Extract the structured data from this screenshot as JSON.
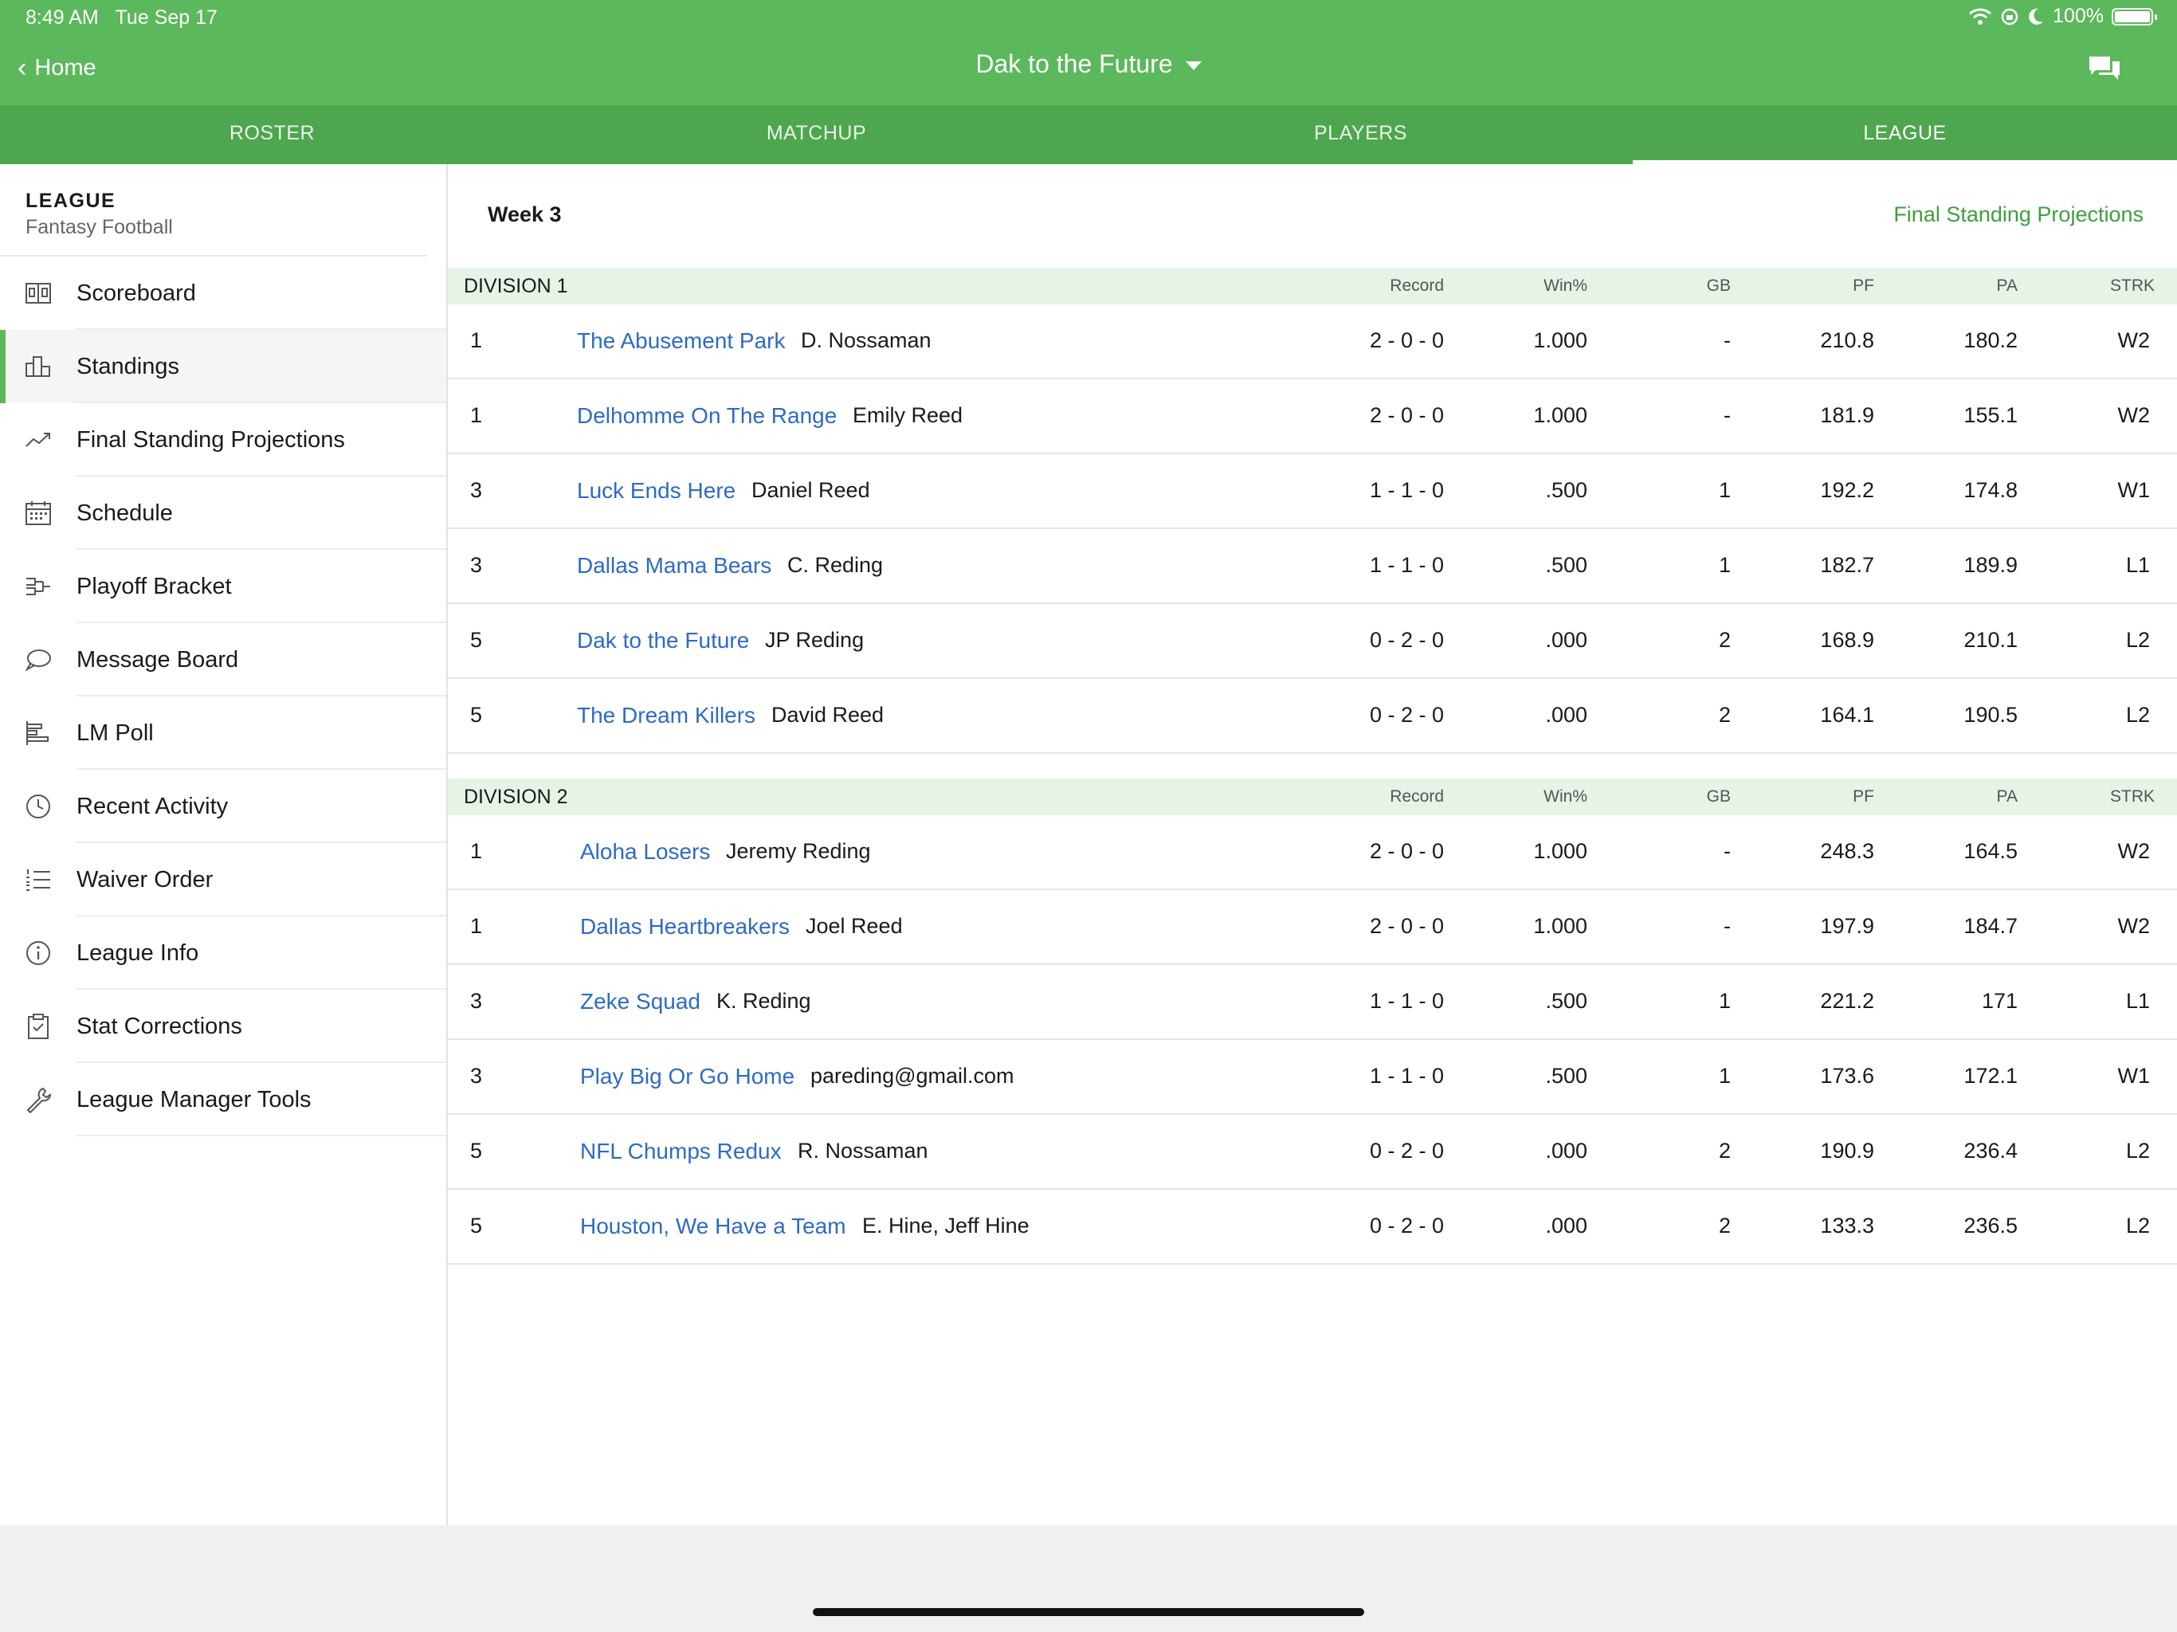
{
  "status_bar": {
    "time": "8:49 AM",
    "date": "Tue Sep 17",
    "battery": "100%",
    "battery_level": 1.0
  },
  "nav": {
    "back_label": "Home",
    "title": "Dak to the Future"
  },
  "tabs": [
    {
      "label": "ROSTER",
      "active": false
    },
    {
      "label": "MATCHUP",
      "active": false
    },
    {
      "label": "PLAYERS",
      "active": false
    },
    {
      "label": "LEAGUE",
      "active": true
    }
  ],
  "sidebar": {
    "title": "LEAGUE",
    "subtitle": "Fantasy Football",
    "items": [
      {
        "label": "Scoreboard",
        "icon": "scoreboard-icon"
      },
      {
        "label": "Standings",
        "icon": "standings-icon",
        "active": true
      },
      {
        "label": "Final Standing Projections",
        "icon": "trend-icon"
      },
      {
        "label": "Schedule",
        "icon": "calendar-icon"
      },
      {
        "label": "Playoff Bracket",
        "icon": "bracket-icon"
      },
      {
        "label": "Message Board",
        "icon": "speech-bubble-icon"
      },
      {
        "label": "LM Poll",
        "icon": "poll-icon"
      },
      {
        "label": "Recent Activity",
        "icon": "clock-icon"
      },
      {
        "label": "Waiver Order",
        "icon": "numbered-list-icon"
      },
      {
        "label": "League Info",
        "icon": "info-icon"
      },
      {
        "label": "Stat Corrections",
        "icon": "clipboard-icon"
      },
      {
        "label": "League Manager Tools",
        "icon": "wrench-icon"
      }
    ]
  },
  "main": {
    "week": "Week 3",
    "projections_link": "Final Standing Projections",
    "columns": {
      "record": "Record",
      "win_pct": "Win%",
      "gb": "GB",
      "pf": "PF",
      "pa": "PA",
      "strk": "STRK"
    },
    "divisions": [
      {
        "name": "DIVISION 1",
        "rows": [
          {
            "rank": "1",
            "team": "The Abusement Park",
            "owner": "D. Nossaman",
            "record": "2 - 0 - 0",
            "win_pct": "1.000",
            "gb": "-",
            "pf": "210.8",
            "pa": "180.2",
            "strk": "W2"
          },
          {
            "rank": "1",
            "team": "Delhomme On The Range",
            "owner": "Emily Reed",
            "record": "2 - 0 - 0",
            "win_pct": "1.000",
            "gb": "-",
            "pf": "181.9",
            "pa": "155.1",
            "strk": "W2"
          },
          {
            "rank": "3",
            "team": "Luck Ends Here",
            "owner": "Daniel Reed",
            "record": "1 - 1 - 0",
            "win_pct": ".500",
            "gb": "1",
            "pf": "192.2",
            "pa": "174.8",
            "strk": "W1"
          },
          {
            "rank": "3",
            "team": "Dallas Mama Bears",
            "owner": "C. Reding",
            "record": "1 - 1 - 0",
            "win_pct": ".500",
            "gb": "1",
            "pf": "182.7",
            "pa": "189.9",
            "strk": "L1"
          },
          {
            "rank": "5",
            "team": "Dak to the Future",
            "owner": "JP Reding",
            "record": "0 - 2 - 0",
            "win_pct": ".000",
            "gb": "2",
            "pf": "168.9",
            "pa": "210.1",
            "strk": "L2"
          },
          {
            "rank": "5",
            "team": "The Dream Killers",
            "owner": "David Reed",
            "record": "0 - 2 - 0",
            "win_pct": ".000",
            "gb": "2",
            "pf": "164.1",
            "pa": "190.5",
            "strk": "L2"
          }
        ]
      },
      {
        "name": "DIVISION 2",
        "rows": [
          {
            "rank": "1",
            "team": "Aloha Losers",
            "owner": "Jeremy Reding",
            "record": "2 - 0 - 0",
            "win_pct": "1.000",
            "gb": "-",
            "pf": "248.3",
            "pa": "164.5",
            "strk": "W2"
          },
          {
            "rank": "1",
            "team": "Dallas Heartbreakers",
            "owner": "Joel Reed",
            "record": "2 - 0 - 0",
            "win_pct": "1.000",
            "gb": "-",
            "pf": "197.9",
            "pa": "184.7",
            "strk": "W2"
          },
          {
            "rank": "3",
            "team": "Zeke Squad",
            "owner": "K. Reding",
            "record": "1 - 1 - 0",
            "win_pct": ".500",
            "gb": "1",
            "pf": "221.2",
            "pa": "171",
            "strk": "L1"
          },
          {
            "rank": "3",
            "team": "Play Big Or Go Home",
            "owner": "pareding@gmail.com",
            "record": "1 - 1 - 0",
            "win_pct": ".500",
            "gb": "1",
            "pf": "173.6",
            "pa": "172.1",
            "strk": "W1"
          },
          {
            "rank": "5",
            "team": "NFL Chumps Redux",
            "owner": "R. Nossaman",
            "record": "0 - 2 - 0",
            "win_pct": ".000",
            "gb": "2",
            "pf": "190.9",
            "pa": "236.4",
            "strk": "L2"
          },
          {
            "rank": "5",
            "team": "Houston, We Have a Team",
            "owner": "E. Hine, Jeff Hine",
            "record": "0 - 2 - 0",
            "win_pct": ".000",
            "gb": "2",
            "pf": "133.3",
            "pa": "236.5",
            "strk": "L2"
          }
        ]
      }
    ]
  },
  "colors": {
    "brand_green": "#5cb85c",
    "tab_green": "#4ea64e",
    "link_blue": "#2d6bc4",
    "division_bg": "#e6f3e6"
  }
}
